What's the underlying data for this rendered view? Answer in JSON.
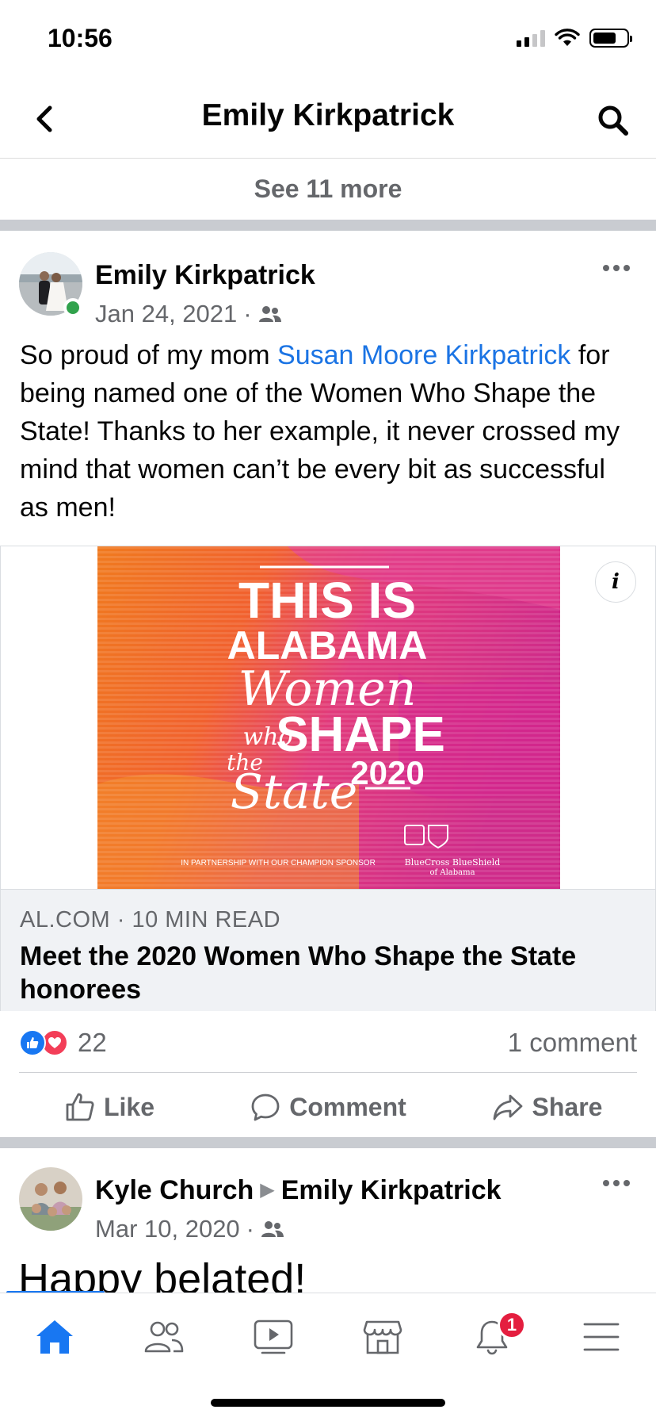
{
  "status_bar": {
    "time": "10:56"
  },
  "header": {
    "title": "Emily Kirkpatrick",
    "see_more": "See 11 more"
  },
  "post1": {
    "author": "Emily Kirkpatrick",
    "date": "Jan 24, 2021",
    "meta_separator": "·",
    "audience_icon": "friends-icon",
    "text_before": "So proud of my mom ",
    "mention": "Susan Moore Kirkpatrick",
    "text_after": " for being named one of the Women Who Shape the State! Thanks to her example, it never crossed my mind that women can’t be every bit as successful as men!",
    "link": {
      "source": "AL.COM · 10 MIN READ",
      "title": "Meet the 2020 Women Who Shape the State honorees",
      "image_text": {
        "line1": "THIS IS",
        "line2": "ALABAMA",
        "line3": "Women",
        "line4a": "who",
        "line4b": "SHAPE",
        "line5a": "the",
        "line5b": "State",
        "year": "2020",
        "sponsor": "IN PARTNERSHIP WITH OUR CHAMPION SPONSOR",
        "sponsor_name": "BlueCross BlueShield",
        "sponsor_sub": "of Alabama"
      }
    },
    "reactions_count": "22",
    "comments": "1 comment",
    "actions": {
      "like": "Like",
      "comment": "Comment",
      "share": "Share"
    }
  },
  "post2": {
    "author": "Kyle Church",
    "arrow": "▶",
    "target": "Emily Kirkpatrick",
    "date": "Mar 10, 2020",
    "meta_separator": "·",
    "text": "Happy belated!"
  },
  "tab_bar": {
    "active": "home",
    "notifications_badge": "1",
    "tabs": [
      "home-icon",
      "friends-icon",
      "watch-icon",
      "marketplace-icon",
      "notifications-icon",
      "menu-icon"
    ]
  },
  "colors": {
    "accent": "#1877f2",
    "mention": "#1b74e4",
    "secondary_text": "#65676b",
    "online": "#31a24c",
    "badge": "#e41e3f"
  }
}
